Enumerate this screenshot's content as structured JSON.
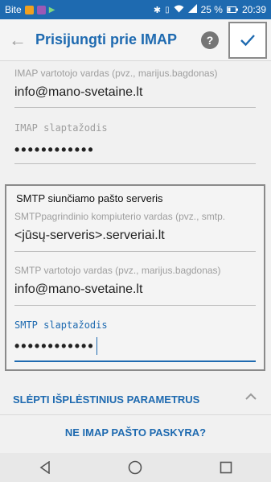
{
  "status": {
    "carrier": "Bite",
    "battery": "25 %",
    "time": "20:39"
  },
  "header": {
    "title": "Prisijungti prie IMAP",
    "help": "?"
  },
  "imap": {
    "username_label": "IMAP vartotojo vardas (pvz., marijus.bagdonas)",
    "username_value": "info@mano-svetaine.lt",
    "password_label": "IMAP slaptažodis",
    "password_value": "••••••••••••"
  },
  "smtp": {
    "title": "SMTP siunčiamo pašto serveris",
    "server_label": "SMTPpagrindinio kompiuterio vardas (pvz., smtp.",
    "server_value": "<jūsų-serveris>.serveriai.lt",
    "username_label": "SMTP vartotojo vardas (pvz., marijus.bagdonas)",
    "username_value": "info@mano-svetaine.lt",
    "password_label": "SMTP slaptažodis",
    "password_value": "••••••••••••"
  },
  "actions": {
    "advanced": "SLĖPTI IŠPLĖSTINIUS PARAMETRUS",
    "not_imap": "NE IMAP PAŠTO PASKYRA?"
  },
  "colors": {
    "accent": "#1e6ab0",
    "statusbar": "#1e6ab0"
  }
}
